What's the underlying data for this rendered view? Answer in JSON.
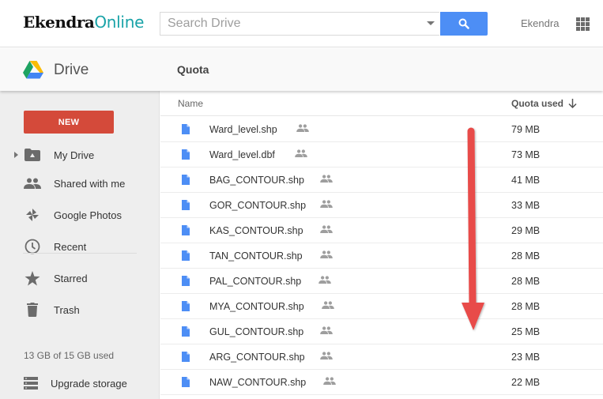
{
  "header": {
    "logo_part1": "Ekendra",
    "logo_part2": "Online",
    "search_placeholder": "Search Drive",
    "search_icon": "search-icon",
    "user_name": "Ekendra",
    "apps_icon": "apps-grid-icon"
  },
  "subheader": {
    "app_title": "Drive",
    "page_title": "Quota"
  },
  "sidebar": {
    "new_label": "NEW",
    "items": [
      {
        "label": "My Drive",
        "icon": "my-drive-folder-icon"
      },
      {
        "label": "Shared with me",
        "icon": "people-icon"
      },
      {
        "label": "Google Photos",
        "icon": "pinwheel-icon"
      },
      {
        "label": "Recent",
        "icon": "clock-icon"
      },
      {
        "label": "Starred",
        "icon": "star-icon"
      },
      {
        "label": "Trash",
        "icon": "trash-icon"
      }
    ],
    "storage_text": "13 GB of 15 GB used",
    "upgrade_label": "Upgrade storage"
  },
  "table": {
    "columns": {
      "name": "Name",
      "quota": "Quota used"
    },
    "sort_direction": "descending",
    "rows": [
      {
        "name": "Ward_level.shp",
        "size": "79 MB",
        "shared": true
      },
      {
        "name": "Ward_level.dbf",
        "size": "73 MB",
        "shared": true
      },
      {
        "name": "BAG_CONTOUR.shp",
        "size": "41 MB",
        "shared": true
      },
      {
        "name": "GOR_CONTOUR.shp",
        "size": "33 MB",
        "shared": true
      },
      {
        "name": "KAS_CONTOUR.shp",
        "size": "29 MB",
        "shared": true
      },
      {
        "name": "TAN_CONTOUR.shp",
        "size": "28 MB",
        "shared": true
      },
      {
        "name": "PAL_CONTOUR.shp",
        "size": "28 MB",
        "shared": true
      },
      {
        "name": "MYA_CONTOUR.shp",
        "size": "28 MB",
        "shared": true
      },
      {
        "name": "GUL_CONTOUR.shp",
        "size": "25 MB",
        "shared": true
      },
      {
        "name": "ARG_CONTOUR.shp",
        "size": "23 MB",
        "shared": true
      },
      {
        "name": "NAW_CONTOUR.shp",
        "size": "22 MB",
        "shared": true
      }
    ]
  },
  "annotation": {
    "arrow_color": "#e84c4a",
    "arrow_direction": "down"
  }
}
